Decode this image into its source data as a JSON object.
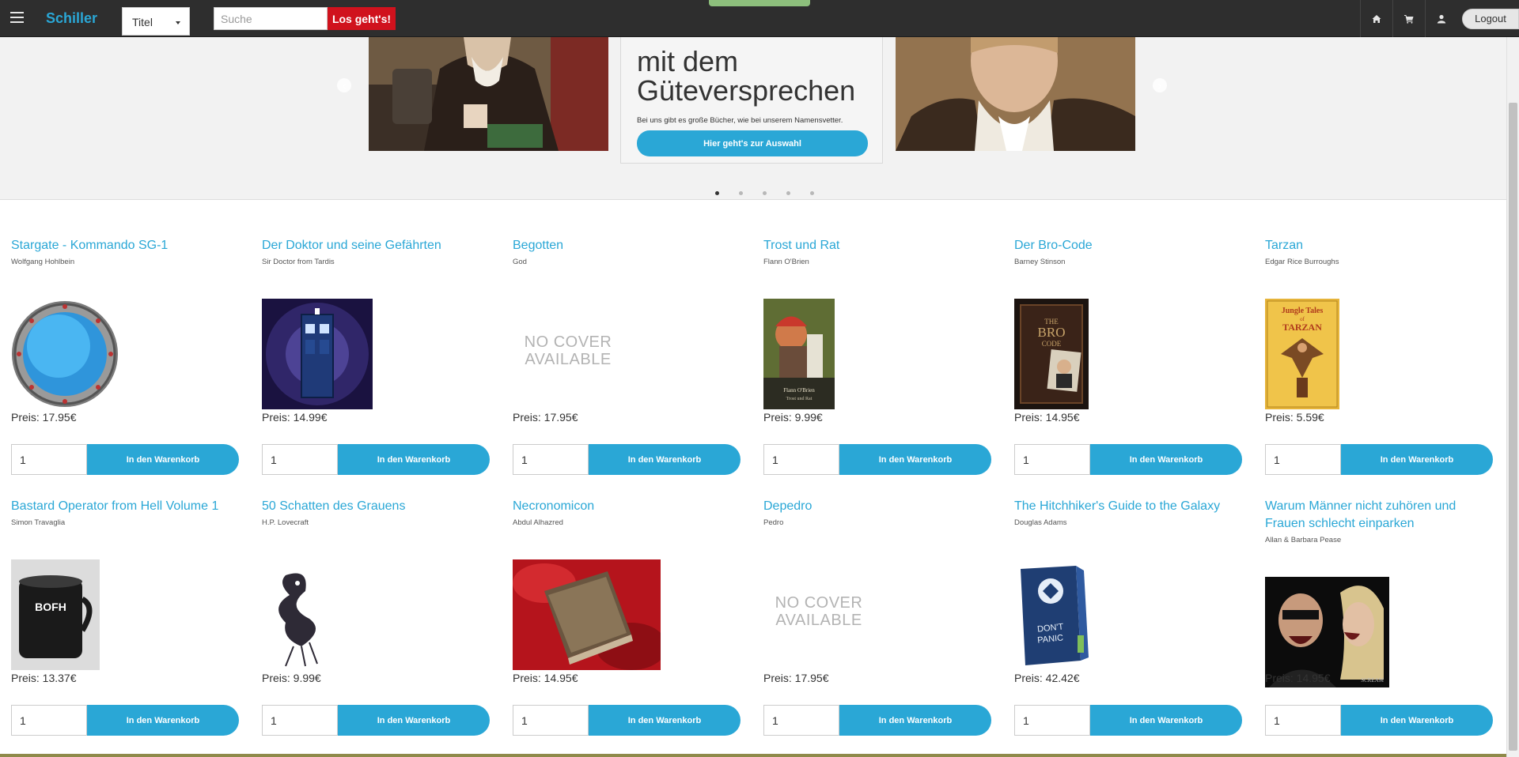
{
  "nav": {
    "brand": "Schiller",
    "select_value": "Titel",
    "search_placeholder": "Suche",
    "search_button": "Los geht's!",
    "icons": [
      "home-icon",
      "cart-icon",
      "user-icon"
    ],
    "logout": "Logout"
  },
  "carousel": {
    "headline_line1": "mit dem",
    "headline_line2": "Güteversprechen",
    "text": "Bei uns gibt es große Bücher, wie bei unserem Namensvetter.",
    "cta": "Hier geht's zur Auswahl",
    "prev_glyph": "‹",
    "next_glyph": "›",
    "slides": 5,
    "active_slide": 1
  },
  "products": [
    {
      "title": "Stargate - Kommando SG-1",
      "author": "Wolfgang Hohlbein",
      "price_label": "Preis: 17.95€",
      "qty": "1",
      "button": "In den Warenkorb",
      "cover": "stargate"
    },
    {
      "title": "Der Doktor und seine Gefährten",
      "author": "Sir Doctor from Tardis",
      "price_label": "Preis: 14.99€",
      "qty": "1",
      "button": "In den Warenkorb",
      "cover": "tardis"
    },
    {
      "title": "Begotten",
      "author": "God",
      "price_label": "Preis: 17.95€",
      "qty": "1",
      "button": "In den Warenkorb",
      "cover": "nocover",
      "nocover_line1": "NO COVER",
      "nocover_line2": "AVAILABLE"
    },
    {
      "title": "Trost und Rat",
      "author": "Flann O'Brien",
      "price_label": "Preis: 9.99€",
      "qty": "1",
      "button": "In den Warenkorb",
      "cover": "trost",
      "cover_text1": "Flann O'Brien",
      "cover_text2": "Trost und Rat"
    },
    {
      "title": "Der Bro-Code",
      "author": "Barney Stinson",
      "price_label": "Preis: 14.95€",
      "qty": "1",
      "button": "In den Warenkorb",
      "cover": "brocode",
      "cover_text1": "THE",
      "cover_text2": "BRO",
      "cover_text3": "CODE"
    },
    {
      "title": "Tarzan",
      "author": "Edgar Rice Burroughs",
      "price_label": "Preis: 5.59€",
      "qty": "1",
      "button": "In den Warenkorb",
      "cover": "tarzan",
      "cover_text1": "Jungle Tales",
      "cover_text2": "of",
      "cover_text3": "TARZAN"
    },
    {
      "title": "Bastard Operator from Hell Volume 1",
      "author": "Simon Travaglia",
      "price_label": "Preis: 13.37€",
      "qty": "1",
      "button": "In den Warenkorb",
      "cover": "bofh",
      "cover_text1": "BOFH"
    },
    {
      "title": "50 Schatten des Grauens",
      "author": "H.P. Lovecraft",
      "price_label": "Preis: 9.99€",
      "qty": "1",
      "button": "In den Warenkorb",
      "cover": "shadow"
    },
    {
      "title": "Necronomicon",
      "author": "Abdul Alhazred",
      "price_label": "Preis: 14.95€",
      "qty": "1",
      "button": "In den Warenkorb",
      "cover": "necro"
    },
    {
      "title": "Depedro",
      "author": "Pedro",
      "price_label": "Preis: 17.95€",
      "qty": "1",
      "button": "In den Warenkorb",
      "cover": "nocover",
      "nocover_line1": "NO COVER",
      "nocover_line2": "AVAILABLE"
    },
    {
      "title": "The Hitchhiker's Guide to the Galaxy",
      "author": "Douglas Adams",
      "price_label": "Preis: 42.42€",
      "qty": "1",
      "button": "In den Warenkorb",
      "cover": "hitchhiker",
      "cover_text1": "DON'T",
      "cover_text2": "PANIC"
    },
    {
      "title": "Warum Männer nicht zuhören und Frauen schlecht einparken",
      "author": "Allan & Barbara Pease",
      "price_label": "Preis: 14.95€",
      "qty": "1",
      "button": "In den Warenkorb",
      "cover": "scream",
      "cover_text1": "SCREAM"
    }
  ],
  "colors": {
    "accent": "#2aa7d6",
    "search_button": "#d0121d",
    "navbar": "#2e2e2e"
  }
}
